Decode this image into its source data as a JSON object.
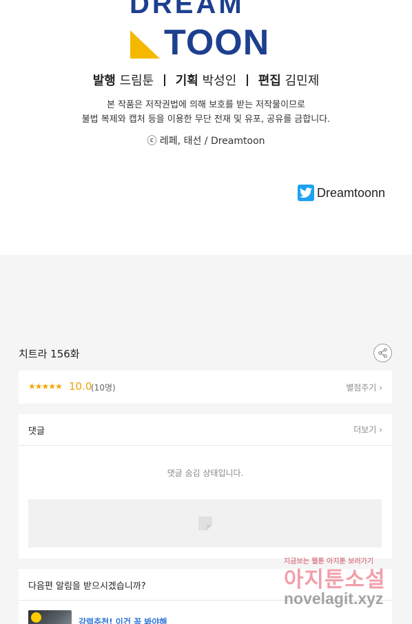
{
  "logo": {
    "top_text": "DREAM",
    "main_text": "TOON",
    "brand_color": "#1d3f8f",
    "accent_color": "#f5b800"
  },
  "staff": {
    "publisher_label": "발행",
    "publisher": "드림툰",
    "planning_label": "기획",
    "planner": "박성인",
    "editing_label": "편집",
    "editor": "김민제"
  },
  "notice": {
    "line1": "본 작품은 저작권법에 의해 보호를 받는 저작물이므로",
    "line2": "불법 복제와 캡처 등을 이용한 무단 전재 및 유포, 공유를 금합니다."
  },
  "copyright": "ⓒ 레페, 태선 / Dreamtoon",
  "twitter": {
    "icon": "twitter-icon",
    "label": "Dreamtoonn"
  },
  "episode": {
    "title": "치트라 156화"
  },
  "rating": {
    "stars": "★★★★★",
    "score": "10.0",
    "count": "(10명)",
    "rate_button": "별점주기",
    "star_color": "#f5a400"
  },
  "comments": {
    "title": "댓글",
    "more": "더보기",
    "hidden_message": "댓글 숨김 상태입니다."
  },
  "next_episode": {
    "title": "다음편 알림을 받으시겠습니까?",
    "recommend": "강력추천! 이건 꼭 봐야해"
  },
  "watermark": {
    "top": "지금보는 웹툰 아지툰 보러가기",
    "mid": "아지툰소설",
    "bottom": "novelagit.xyz"
  }
}
